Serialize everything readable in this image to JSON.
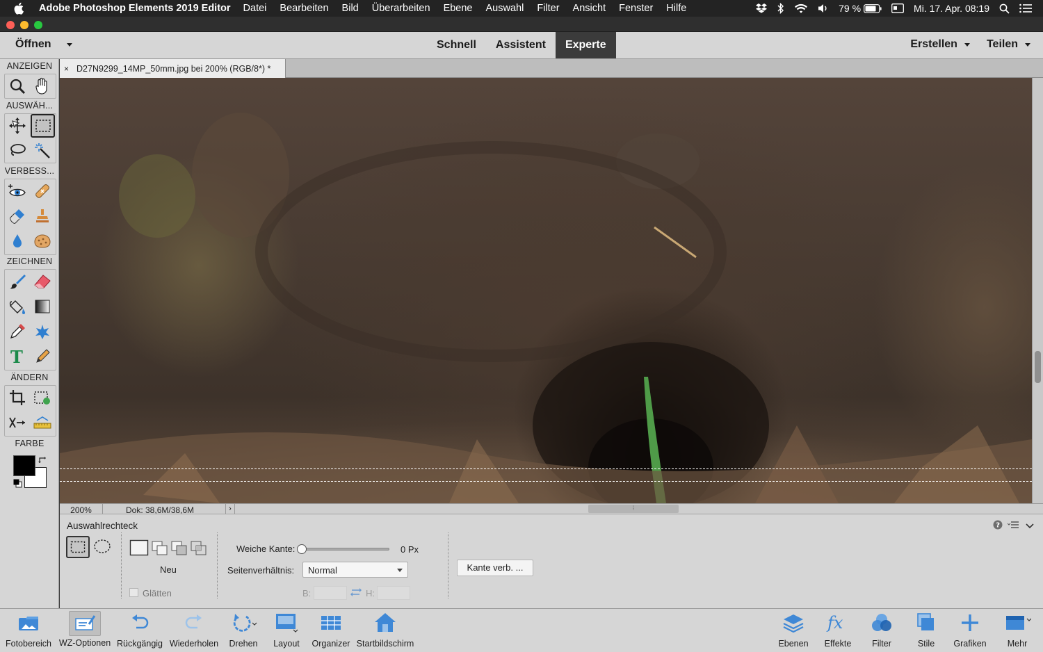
{
  "menubar": {
    "app_name": "Adobe Photoshop Elements 2019 Editor",
    "items": [
      "Datei",
      "Bearbeiten",
      "Bild",
      "Überarbeiten",
      "Ebene",
      "Auswahl",
      "Filter",
      "Ansicht",
      "Fenster",
      "Hilfe"
    ],
    "battery": "79 %",
    "datetime": "Mi. 17. Apr.  08:19"
  },
  "topbar": {
    "open_label": "Öffnen",
    "modes": [
      "Schnell",
      "Assistent",
      "Experte"
    ],
    "active_mode": "Experte",
    "create_label": "Erstellen",
    "share_label": "Teilen"
  },
  "toolbox": {
    "sections": [
      "ANZEIGEN",
      "AUSWÄH...",
      "VERBESS...",
      "ZEICHNEN",
      "ÄNDERN",
      "FARBE"
    ]
  },
  "document": {
    "tab_title": "D27N9299_14MP_50mm.jpg bei 200% (RGB/8*) *",
    "zoom": "200%",
    "doc_size": "Dok: 38,6M/38,6M"
  },
  "options": {
    "tool_name": "Auswahlrechteck",
    "mode_label": "Neu",
    "smooth_label": "Glätten",
    "feather_label": "Weiche Kante:",
    "feather_value": "0 Px",
    "feather_fraction": 0,
    "aspect_label": "Seitenverhältnis:",
    "aspect_value": "Normal",
    "width_label": "B:",
    "height_label": "H:",
    "refine_button": "Kante verb. ..."
  },
  "bottombar": {
    "left": [
      "Fotobereich",
      "WZ-Optionen",
      "Rückgängig",
      "Wiederholen",
      "Drehen",
      "Layout",
      "Organizer",
      "Startbildschirm"
    ],
    "right": [
      "Ebenen",
      "Effekte",
      "Filter",
      "Stile",
      "Grafiken",
      "Mehr"
    ]
  },
  "colors": {
    "foreground": "#000000",
    "background": "#ffffff",
    "accent_blue": "#2f7fd0"
  }
}
